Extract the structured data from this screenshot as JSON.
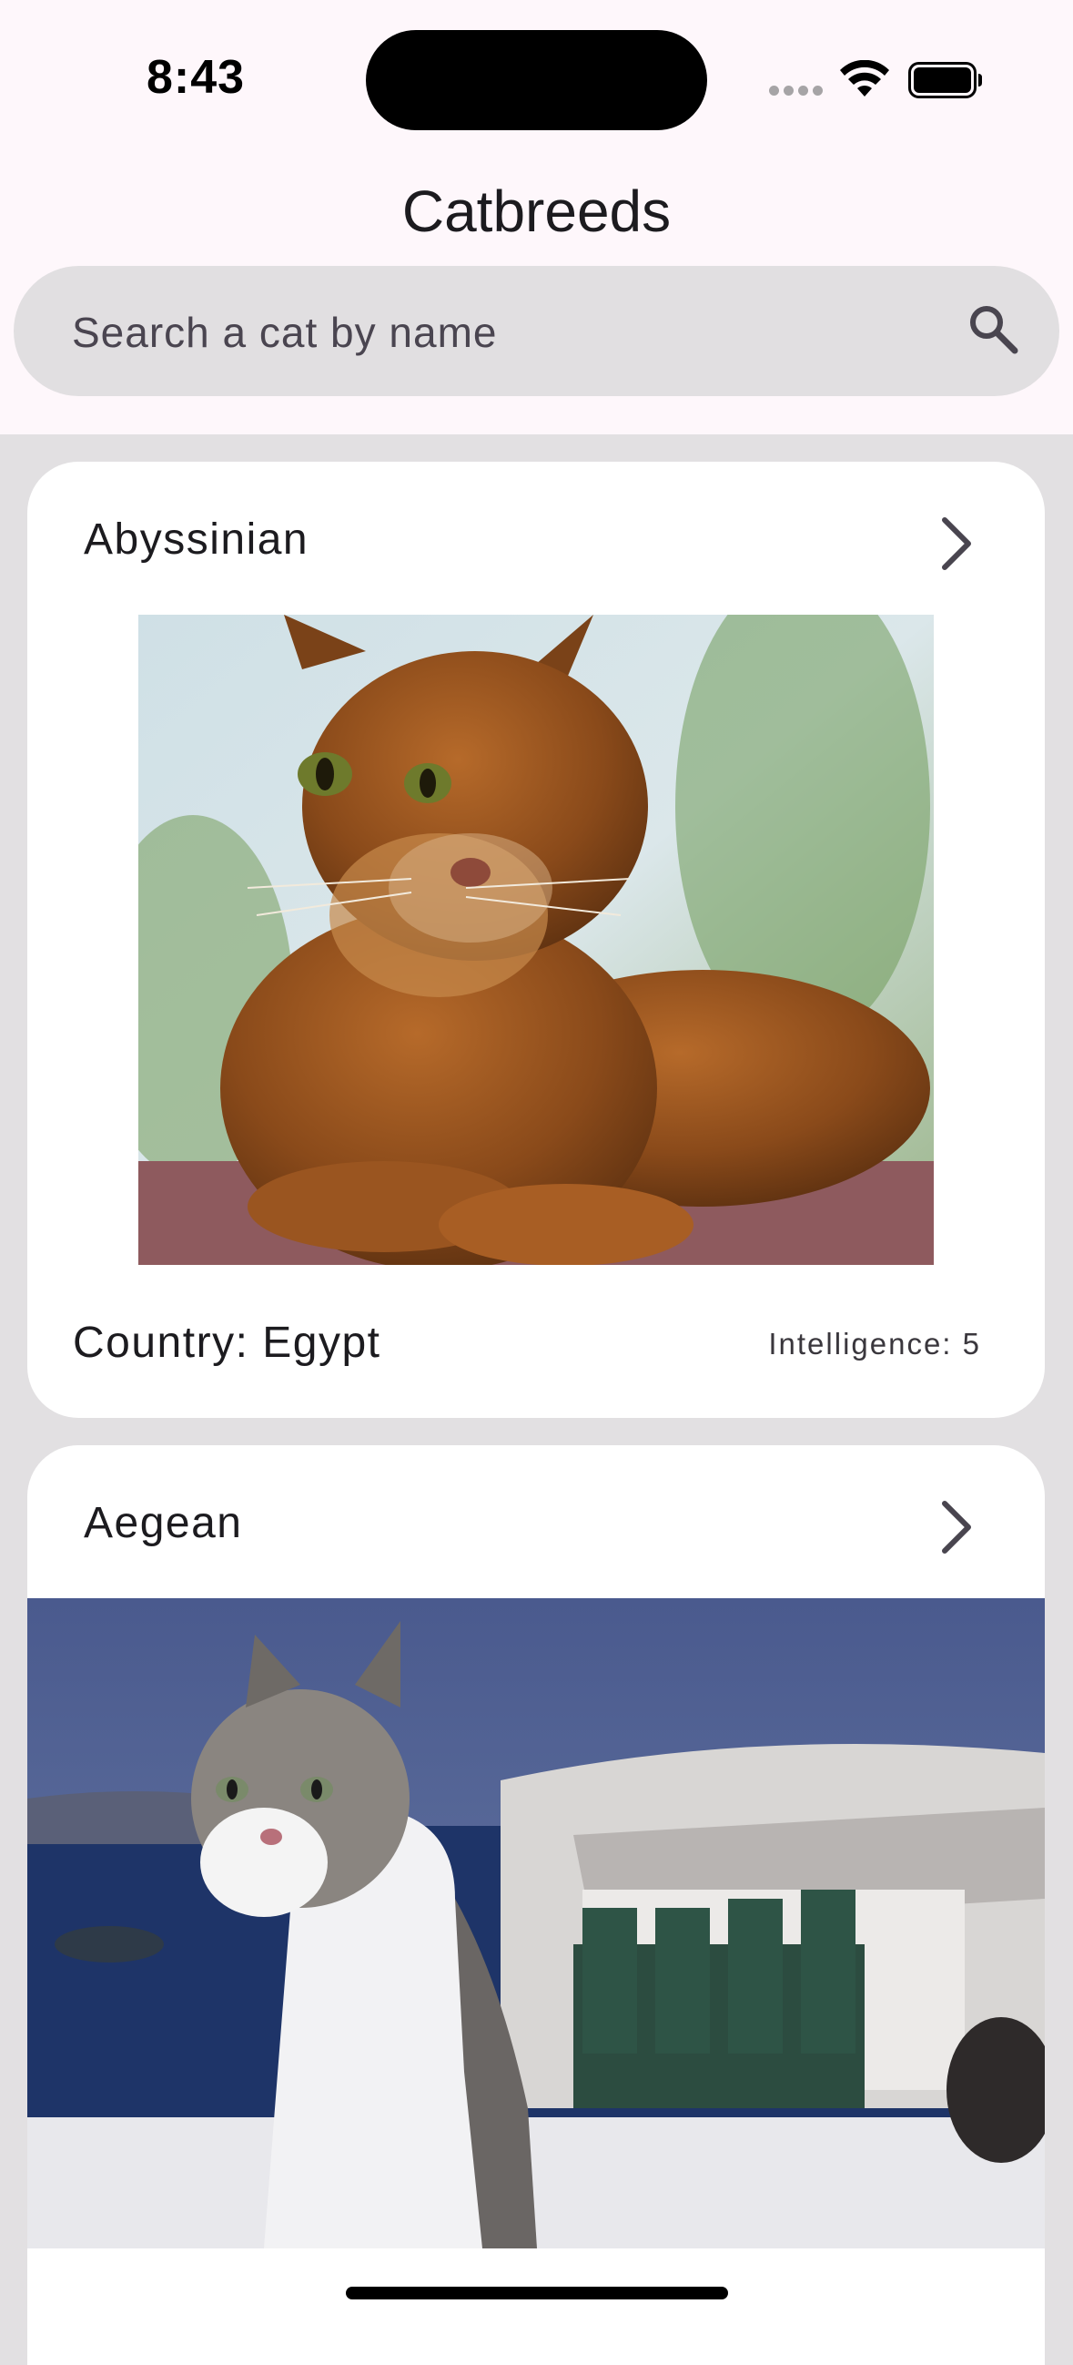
{
  "status_bar": {
    "time": "8:43",
    "icons": [
      "signal-icon",
      "wifi-icon",
      "battery-icon"
    ]
  },
  "header": {
    "title": "Catbreeds"
  },
  "search": {
    "placeholder": "Search a cat by name",
    "value": "",
    "icon": "search-icon"
  },
  "breeds": [
    {
      "name": "Abyssinian",
      "country_label": "Country: Egypt",
      "intelligence_label": "Intelligence: 5",
      "icon": "chevron-right-icon"
    },
    {
      "name": "Aegean",
      "icon": "chevron-right-icon"
    }
  ],
  "colors": {
    "background": "#e2e0e2",
    "header": "#fef7fb",
    "search_bg": "#e1dfe1",
    "card": "#ffffff",
    "text": "#1c1b1f"
  }
}
